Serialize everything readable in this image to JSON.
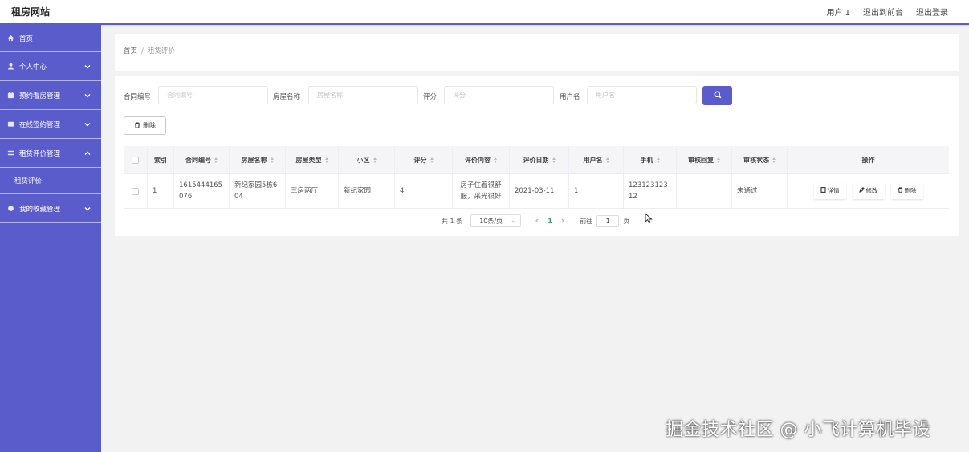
{
  "header": {
    "site_title": "租房网站",
    "user": "用户 1",
    "back_to_front": "退出到前台",
    "logout": "退出登录"
  },
  "sidebar": {
    "items": [
      {
        "label": "首页",
        "icon": "home-icon"
      },
      {
        "label": "个人中心",
        "icon": "user-icon"
      },
      {
        "label": "预约看房管理",
        "icon": "calendar-icon"
      },
      {
        "label": "在线签约管理",
        "icon": "contract-icon"
      },
      {
        "label": "租赁评价管理",
        "icon": "list-icon"
      },
      {
        "label": "我的收藏管理",
        "icon": "star-icon"
      }
    ],
    "submenu_label": "租赁评价"
  },
  "breadcrumb": {
    "home": "首页",
    "separator": "/",
    "current": "租赁评价"
  },
  "search": {
    "contract_no_label": "合同编号",
    "contract_no_placeholder": "合同编号",
    "house_name_label": "房屋名称",
    "house_name_placeholder": "房屋名称",
    "score_label": "评分",
    "score_placeholder": "评分",
    "username_label": "用户名",
    "username_placeholder": "用户名"
  },
  "toolbar": {
    "delete_label": "删除"
  },
  "table": {
    "headers": {
      "index": "索引",
      "contract_no": "合同编号",
      "house_name": "房屋名称",
      "house_type": "房屋类型",
      "community": "小区",
      "score": "评分",
      "content": "评价内容",
      "date": "评价日期",
      "username": "用户名",
      "phone": "手机",
      "reply": "审核回复",
      "status": "审核状态",
      "ops": "操作"
    },
    "rows": [
      {
        "index": "1",
        "contract_no": "1615444165076",
        "house_name": "新纪家园5栋604",
        "house_type": "三房两厅",
        "community": "新纪家园",
        "score": "4",
        "content": "房子住着很舒服，采光很好",
        "date": "2021-03-11",
        "username": "1",
        "phone": "12312312312",
        "reply": "",
        "status": "未通过"
      }
    ],
    "ops": {
      "detail": "详情",
      "edit": "修改",
      "delete": "删除"
    }
  },
  "pagination": {
    "total": "共 1 条",
    "page_size": "10条/页",
    "current_page": "1",
    "goto_label": "前往",
    "goto_value": "1",
    "goto_suffix": "页"
  },
  "watermark": "掘金技术社区 @ 小飞计算机毕设",
  "colors": {
    "accent": "#5b5ccc",
    "sidebar_bg": "#5b5ccc",
    "page_bg": "#f2f2f2",
    "active_page": "#409e6a"
  }
}
